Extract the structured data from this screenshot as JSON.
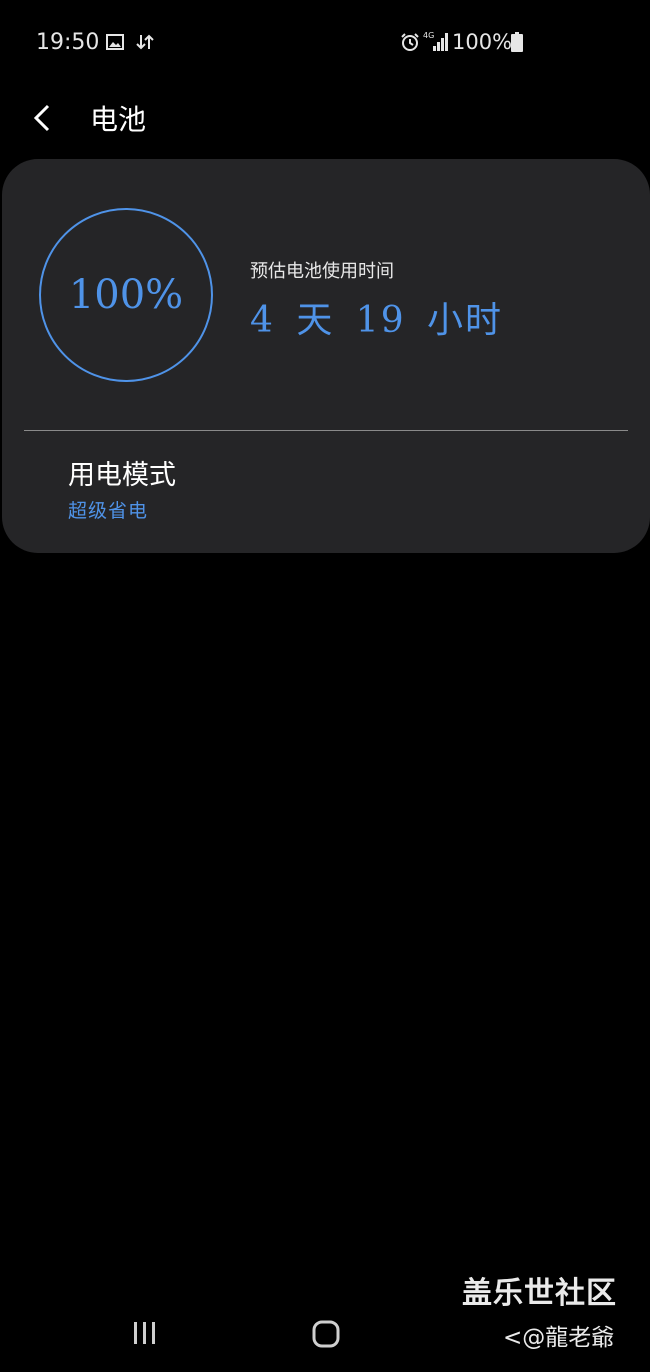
{
  "status_bar": {
    "time": "19:50",
    "battery_text": "100%",
    "icons": [
      "image-icon",
      "data-transfer-icon",
      "alarm-icon",
      "4g-signal-icon",
      "battery-icon"
    ]
  },
  "header": {
    "title": "电池",
    "back_icon": "chevron-left-icon"
  },
  "battery": {
    "percent_label": "100%",
    "percent": 100,
    "estimate_label": "预估电池使用时间",
    "estimate_value": "4 天 19 小时"
  },
  "power_mode": {
    "title": "用电模式",
    "value": "超级省电"
  },
  "nav_bar": {
    "buttons": [
      "recent-apps-icon",
      "home-icon"
    ]
  },
  "watermark": {
    "site": "盖乐世社区",
    "user": "<@龍老爺"
  },
  "colors": {
    "background": "#000000",
    "card": "#252527",
    "accent": "#4f93e8",
    "text_primary": "#ffffff",
    "divider": "#8a8a8a"
  }
}
